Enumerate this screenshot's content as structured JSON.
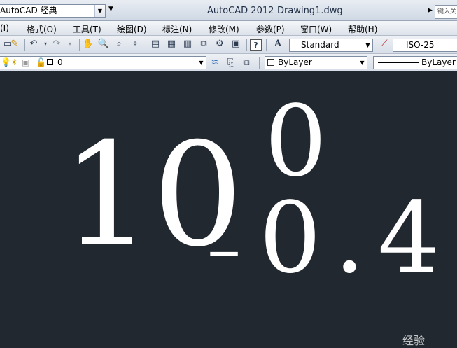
{
  "title_bar": {
    "workspace": "AutoCAD 经典",
    "app_name": "AutoCAD 2012",
    "document": "Drawing1.dwg",
    "help_search_placeholder": "键入关"
  },
  "menu": [
    {
      "label": "(I)"
    },
    {
      "label": "格式(O)"
    },
    {
      "label": "工具(T)"
    },
    {
      "label": "绘图(D)"
    },
    {
      "label": "标注(N)"
    },
    {
      "label": "修改(M)"
    },
    {
      "label": "参数(P)"
    },
    {
      "label": "窗口(W)"
    },
    {
      "label": "帮助(H)"
    }
  ],
  "styles_toolbar": {
    "text_style": "Standard",
    "dim_style": "ISO-25"
  },
  "layers_toolbar": {
    "current_layer": "0",
    "color": "ByLayer",
    "linetype": "ByLayer"
  },
  "canvas": {
    "main_text": "10",
    "upper_tolerance": "0",
    "lower_tolerance_sign": "-",
    "lower_tolerance": "0.4",
    "watermark": "经验"
  },
  "colors": {
    "canvas_background": "#212830",
    "drawing_text": "#ffffff"
  }
}
